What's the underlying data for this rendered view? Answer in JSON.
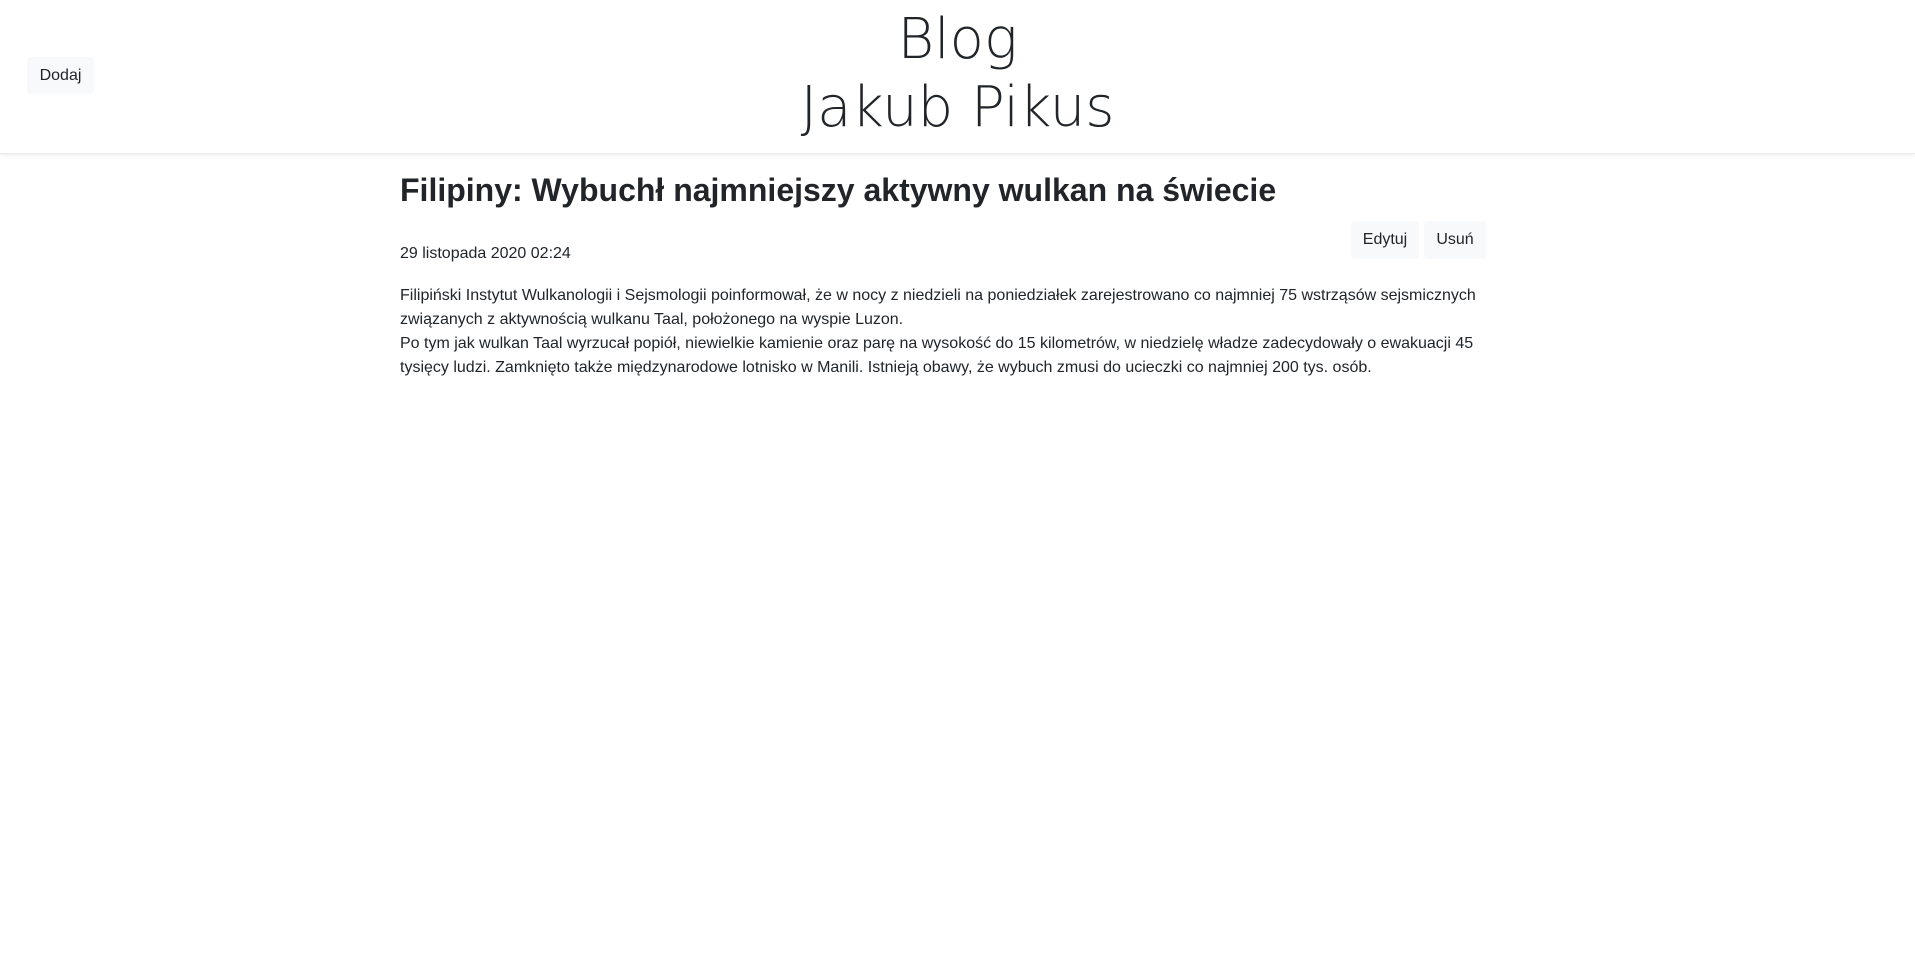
{
  "header": {
    "add_label": "Dodaj",
    "title_line1": "Blog",
    "title_line2": "Jakub Pikus"
  },
  "post": {
    "title": "Filipiny: Wybuchł najmniejszy aktywny wulkan na świecie",
    "date": "29 listopada 2020 02:24",
    "edit_label": "Edytuj",
    "delete_label": "Usuń",
    "paragraphs": [
      "Filipiński Instytut Wulkanologii i Sejsmologii poinformował, że w nocy z niedzieli na poniedziałek zarejestrowano co najmniej 75 wstrząsów sejsmicznych związanych z aktywnością wulkanu Taal, położonego na wyspie Luzon.",
      "Po tym jak wulkan Taal wyrzucał popiół, niewielkie kamienie oraz parę na wysokość do 15 kilometrów, w niedzielę władze zadecydowały o ewakuacji 45 tysięcy ludzi. Zamknięto także międzynarodowe lotnisko w Manili. Istnieją obawy, że wybuch zmusi do ucieczki co najmniej 200 tys. osób."
    ]
  },
  "colors": {
    "text": "#212529",
    "button_bg": "#f8f9fa",
    "background": "#ffffff"
  }
}
